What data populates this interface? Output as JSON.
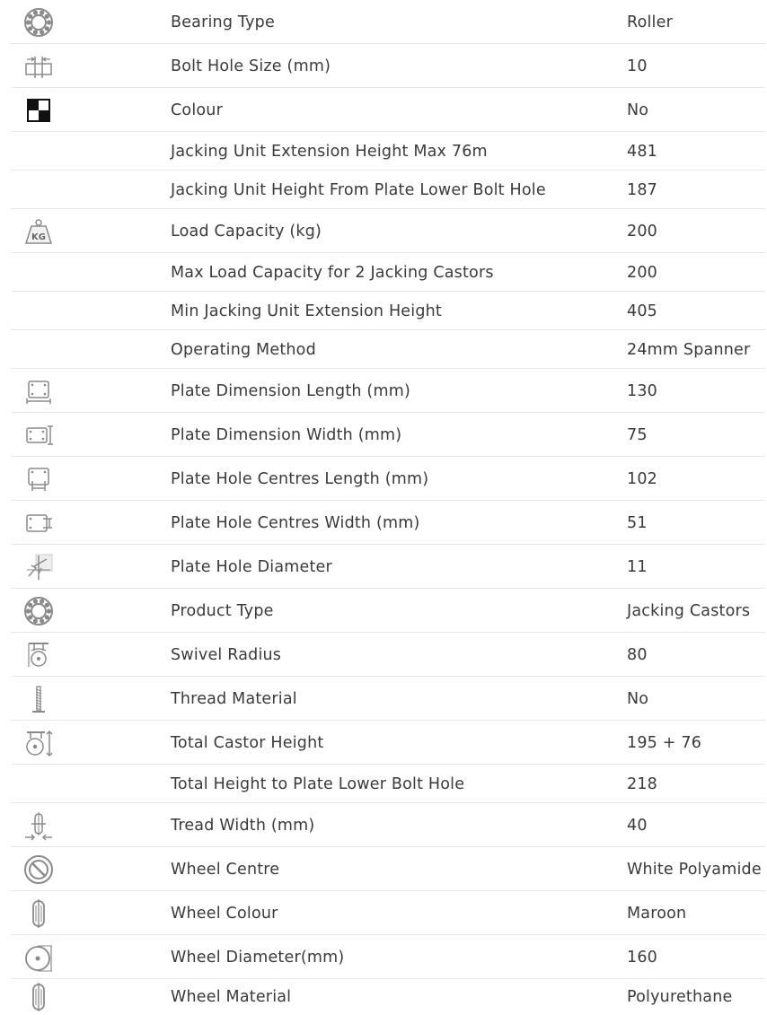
{
  "specs": [
    {
      "label": "Bearing Type",
      "value": "Roller",
      "icon": "bearing-icon"
    },
    {
      "label": "Bolt Hole Size (mm)",
      "value": "10",
      "icon": "bolt-hole-icon"
    },
    {
      "label": "Colour",
      "value": "No",
      "icon": "colour-swatch-icon"
    },
    {
      "label": "Jacking Unit Extension Height Max 76m",
      "value": "481",
      "icon": ""
    },
    {
      "label": "Jacking Unit Height From Plate Lower Bolt Hole",
      "value": "187",
      "icon": ""
    },
    {
      "label": "Load Capacity (kg)",
      "value": "200",
      "icon": "kg-weight-icon"
    },
    {
      "label": "Max Load Capacity for 2 Jacking Castors",
      "value": "200",
      "icon": ""
    },
    {
      "label": "Min Jacking Unit Extension Height",
      "value": "405",
      "icon": ""
    },
    {
      "label": "Operating Method",
      "value": "24mm Spanner",
      "icon": ""
    },
    {
      "label": "Plate Dimension Length (mm)",
      "value": "130",
      "icon": "plate-length-icon"
    },
    {
      "label": "Plate Dimension Width (mm)",
      "value": "75",
      "icon": "plate-width-icon"
    },
    {
      "label": "Plate Hole Centres Length (mm)",
      "value": "102",
      "icon": "plate-hole-length-icon"
    },
    {
      "label": "Plate Hole Centres Width (mm)",
      "value": "51",
      "icon": "plate-hole-width-icon"
    },
    {
      "label": "Plate Hole Diameter",
      "value": "11",
      "icon": "hole-diameter-icon"
    },
    {
      "label": "Product Type",
      "value": "Jacking Castors",
      "icon": "bearing-icon"
    },
    {
      "label": "Swivel Radius",
      "value": "80",
      "icon": "swivel-radius-icon"
    },
    {
      "label": "Thread Material",
      "value": "No",
      "icon": "thread-icon"
    },
    {
      "label": "Total Castor Height",
      "value": "195 + 76",
      "icon": "castor-height-icon"
    },
    {
      "label": "Total Height to Plate Lower Bolt Hole",
      "value": "218",
      "icon": ""
    },
    {
      "label": "Tread Width (mm)",
      "value": "40",
      "icon": "tread-width-icon"
    },
    {
      "label": "Wheel Centre",
      "value": "White Polyamide",
      "icon": "wheel-centre-icon"
    },
    {
      "label": "Wheel Colour",
      "value": "Maroon",
      "icon": "wheel-side-icon"
    },
    {
      "label": "Wheel Diameter(mm)",
      "value": "160",
      "icon": "wheel-diameter-icon"
    },
    {
      "label": "Wheel Material",
      "value": "Polyurethane",
      "icon": "wheel-side-icon"
    }
  ]
}
